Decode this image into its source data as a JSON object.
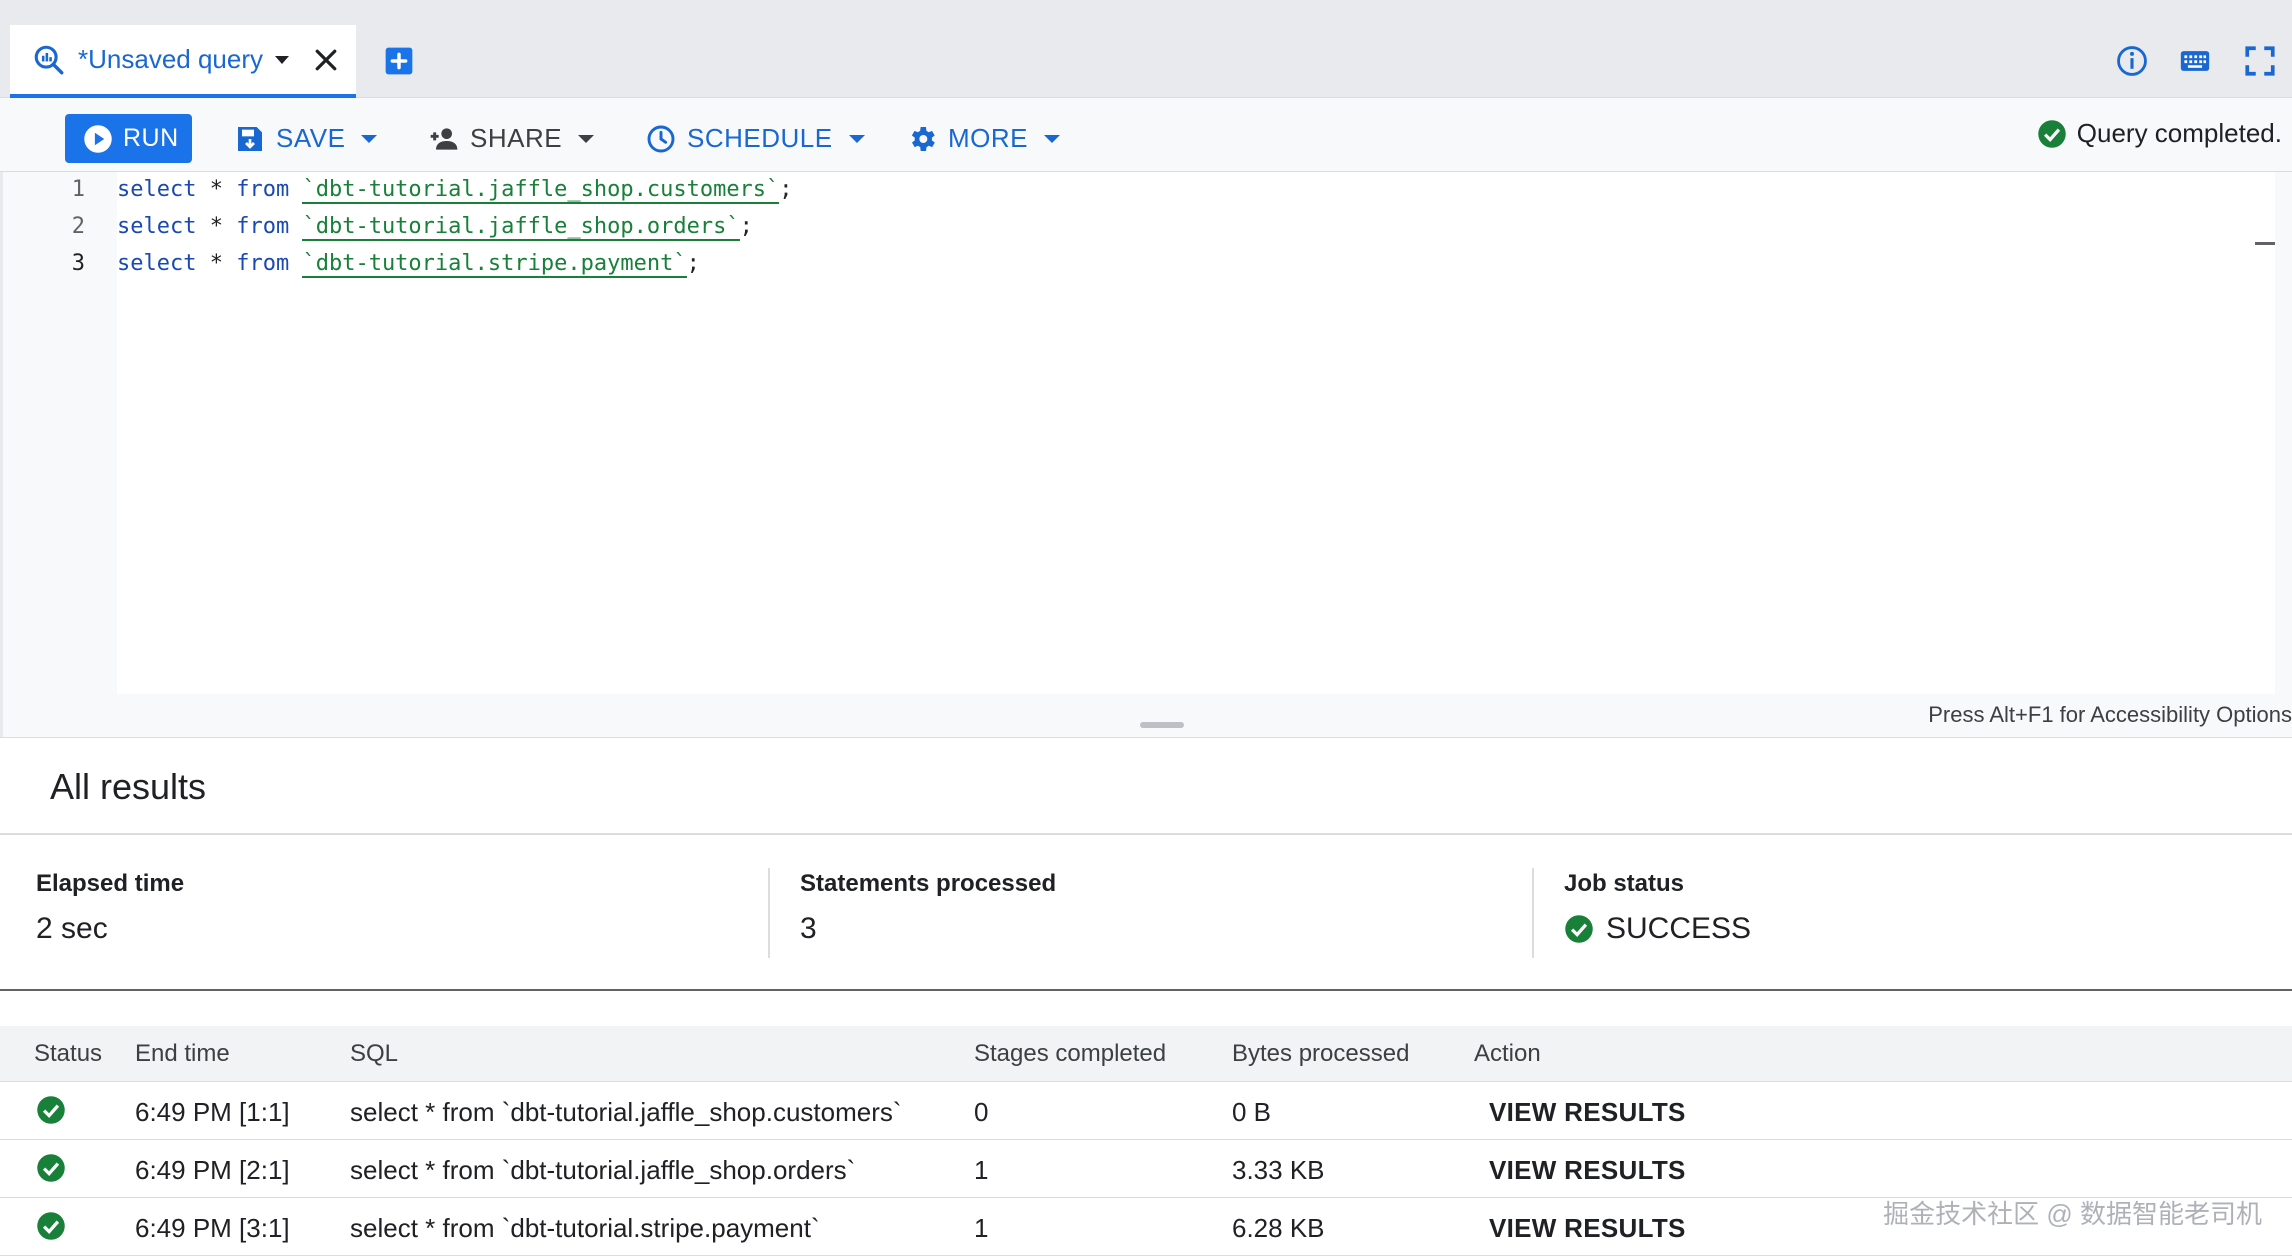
{
  "tab": {
    "title": "*Unsaved query"
  },
  "toolbar": {
    "run_label": "RUN",
    "save_label": "SAVE",
    "share_label": "SHARE",
    "schedule_label": "SCHEDULE",
    "more_label": "MORE",
    "status_text": "Query completed."
  },
  "editor": {
    "lines": [
      {
        "num": "1",
        "kw1": "select",
        "star": " * ",
        "kw2": "from",
        "table": "`dbt-tutorial.jaffle_shop.customers`",
        "end": ";"
      },
      {
        "num": "2",
        "kw1": "select",
        "star": " * ",
        "kw2": "from",
        "table": "`dbt-tutorial.jaffle_shop.orders`",
        "end": ";"
      },
      {
        "num": "3",
        "kw1": "select",
        "star": " * ",
        "kw2": "from",
        "table": "`dbt-tutorial.stripe.payment`",
        "end": ";"
      }
    ],
    "accessibility_hint": "Press Alt+F1 for Accessibility Options"
  },
  "results": {
    "title": "All results",
    "summary": {
      "elapsed_label": "Elapsed time",
      "elapsed_value": "2 sec",
      "statements_label": "Statements processed",
      "statements_value": "3",
      "job_label": "Job status",
      "job_value": "SUCCESS"
    },
    "columns": [
      "Status",
      "End time",
      "SQL",
      "Stages completed",
      "Bytes processed",
      "Action"
    ],
    "rows": [
      {
        "end_time": "6:49 PM [1:1]",
        "sql": "select * from `dbt-tutorial.jaffle_shop.customers`",
        "stages": "0",
        "bytes": "0 B",
        "action": "VIEW RESULTS"
      },
      {
        "end_time": "6:49 PM [2:1]",
        "sql": "select * from `dbt-tutorial.jaffle_shop.orders`",
        "stages": "1",
        "bytes": "3.33 KB",
        "action": "VIEW RESULTS"
      },
      {
        "end_time": "6:49 PM [3:1]",
        "sql": "select * from `dbt-tutorial.stripe.payment`",
        "stages": "1",
        "bytes": "6.28 KB",
        "action": "VIEW RESULTS"
      }
    ]
  },
  "watermark": "掘金技术社区 @ 数据智能老司机",
  "colors": {
    "accent": "#1a73e8",
    "success": "#188038",
    "keyword": "#1a49b3"
  }
}
